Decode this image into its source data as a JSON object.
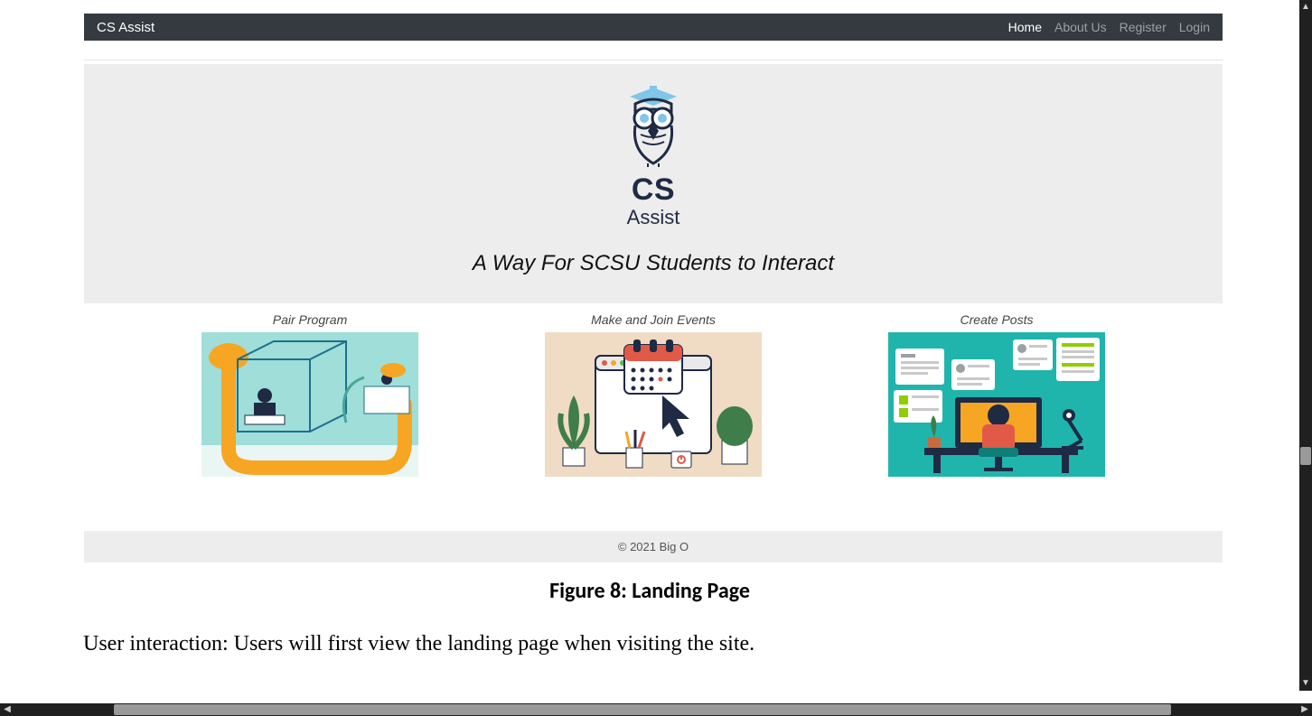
{
  "navbar": {
    "brand": "CS Assist",
    "links": [
      {
        "label": "Home",
        "active": true
      },
      {
        "label": "About Us",
        "active": false
      },
      {
        "label": "Register",
        "active": false
      },
      {
        "label": "Login",
        "active": false
      }
    ]
  },
  "hero": {
    "logo_line1": "CS",
    "logo_line2": "Assist",
    "tagline": "A Way For SCSU Students to Interact"
  },
  "features": [
    {
      "title": "Pair Program"
    },
    {
      "title": "Make and Join Events"
    },
    {
      "title": "Create Posts"
    }
  ],
  "footer": "© 2021 Big O",
  "figure_caption": "Figure 8: Landing Page",
  "body_text": "User interaction: Users will first view the landing page when visiting the site."
}
